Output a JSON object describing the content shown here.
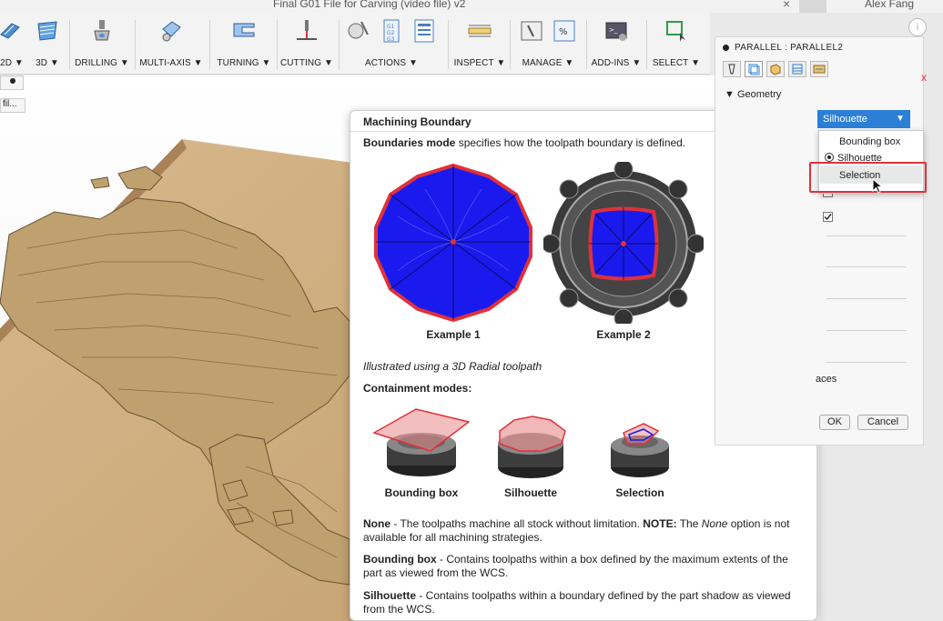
{
  "window": {
    "title": "Final G01 File for Carving (video file) v2",
    "user": "Alex Fang"
  },
  "toolbar": {
    "groups": [
      {
        "label": "2D ▼"
      },
      {
        "label": "3D ▼"
      },
      {
        "label": "DRILLING ▼"
      },
      {
        "label": "MULTI-AXIS ▼"
      },
      {
        "label": "TURNING ▼"
      },
      {
        "label": "CUTTING ▼"
      },
      {
        "label": "ACTIONS ▼"
      },
      {
        "label": "INSPECT ▼"
      },
      {
        "label": "MANAGE ▼"
      },
      {
        "label": "ADD-INS ▼"
      },
      {
        "label": "SELECT ▼"
      }
    ]
  },
  "left_strip": {
    "item2": "fil..."
  },
  "help": {
    "title": "Machining Boundary",
    "intro_bold": "Boundaries mode",
    "intro_rest": " specifies how the toolpath boundary is defined.",
    "example1": "Example 1",
    "example2": "Example 2",
    "illustrated": "Illustrated using a 3D Radial toolpath",
    "containment": "Containment modes:",
    "modes": [
      "Bounding box",
      "Silhouette",
      "Selection"
    ],
    "none_bold": "None",
    "none_text": " - The toolpaths machine all stock without limitation. ",
    "note_bold": "NOTE:",
    "note_text1": " The ",
    "note_italic": "None",
    "note_text2": " option is not available for all machining strategies.",
    "bbox_bold": "Bounding box",
    "bbox_text": " - Contains toolpaths within a box defined by the maximum extents of the part as viewed from the WCS.",
    "sil_bold": "Silhouette",
    "sil_text": " - Contains toolpaths within a boundary defined by the part shadow as viewed from the WCS."
  },
  "panel": {
    "title": "PARALLEL : PARALLEL2",
    "geometry": "Geometry",
    "faces_partial": "aces",
    "ok": "OK",
    "cancel": "Cancel"
  },
  "dropdown": {
    "selected": "Silhouette",
    "options": [
      "Bounding box",
      "Silhouette",
      "Selection"
    ]
  },
  "colors": {
    "accent": "#2b7fd6",
    "highlight": "#e0313a",
    "toolpath": "#1a1aee"
  }
}
